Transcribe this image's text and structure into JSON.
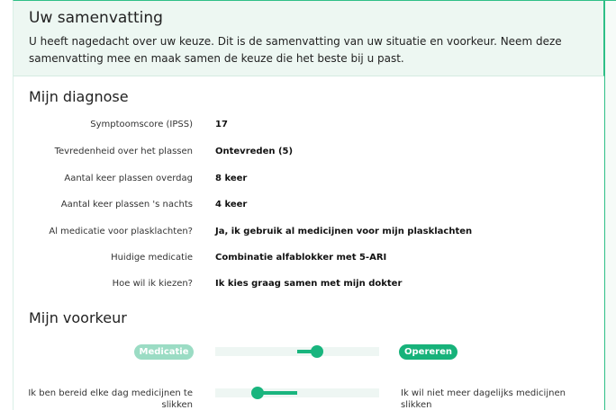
{
  "summary": {
    "title": "Uw samenvatting",
    "text": "U heeft nagedacht over uw keuze. Dit is de samenvatting van uw situatie en voorkeur. Neem deze samenvatting mee en maak samen de keuze die het beste bij u past."
  },
  "diagnosis": {
    "title": "Mijn diagnose",
    "rows": [
      {
        "label": "Symptoomscore (IPSS)",
        "value": "17"
      },
      {
        "label": "Tevredenheid over het plassen",
        "value": "Ontevreden (5)"
      },
      {
        "label": "Aantal keer plassen overdag",
        "value": "8 keer"
      },
      {
        "label": "Aantal keer plassen 's nachts",
        "value": "4 keer"
      },
      {
        "label": "Al medicatie voor plasklachten?",
        "value": "Ja, ik gebruik al medicijnen voor mijn plasklachten"
      },
      {
        "label": "Huidige medicatie",
        "value": "Combinatie alfablokker met 5-ARI"
      },
      {
        "label": "Hoe wil ik kiezen?",
        "value": "Ik kies graag samen met mijn dokter"
      }
    ]
  },
  "preference": {
    "title": "Mijn voorkeur",
    "left_option": "Medicatie",
    "right_option": "Opereren",
    "slider_1": {
      "value": 0.62,
      "direction": "right"
    },
    "slider_2": {
      "left_text": "Ik ben bereid elke dag medicijnen te slikken",
      "right_text": "Ik wil niet meer dagelijks medicijnen slikken",
      "value": 0.26,
      "direction": "left"
    }
  },
  "colors": {
    "accent": "#19b57e",
    "accent_light": "#9bdcc4",
    "summary_bg": "#edf7f2"
  }
}
